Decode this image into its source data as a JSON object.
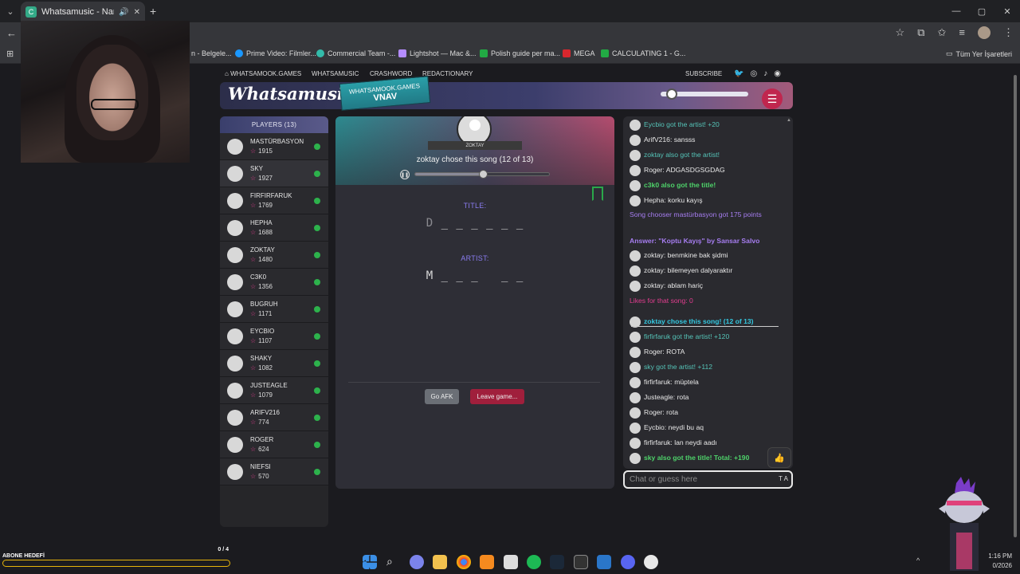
{
  "browser": {
    "tab_title": "Whatsamusic - Name That",
    "tab_menu": "⌄",
    "new_tab": "+",
    "win_controls": [
      "—",
      "▢",
      "✕"
    ],
    "back": "←",
    "bookmarks": [
      {
        "label": "n - Belgele...",
        "color": "#888888"
      },
      {
        "label": "Prime Video: Filmler...",
        "color": "#1a98ff"
      },
      {
        "label": "Commercial Team -...",
        "color": "#33bbaa"
      },
      {
        "label": "Lightshot — Mac &...",
        "color": "#b48cff"
      },
      {
        "label": "Polish guide per ma...",
        "color": "#22aa44"
      },
      {
        "label": "MEGA",
        "color": "#d9272e"
      },
      {
        "label": "CALCULATING 1 - G...",
        "color": "#22aa44"
      }
    ],
    "bookmarks_right": "Tüm Yer İşaretleri"
  },
  "site_nav": {
    "home": "WHATSAMOOK.GAMES",
    "links": [
      "WHATSAMUSIC",
      "CRASHWORD",
      "REDACTIONARY"
    ],
    "subscribe": "SUBSCRIBE"
  },
  "header": {
    "logo": "Whatsamusic",
    "badge_top": "WHATSAMOOK.GAMES",
    "badge_bottom": "VNAV",
    "menu_icon": "☰"
  },
  "players": {
    "title": "PLAYERS (13)",
    "list": [
      {
        "name": "MASTÜRBASYON",
        "score": "1915"
      },
      {
        "name": "SKY",
        "score": "1927"
      },
      {
        "name": "FIRFIRFARUK",
        "score": "1769"
      },
      {
        "name": "HEPHA",
        "score": "1688"
      },
      {
        "name": "ZOKTAY",
        "score": "1480"
      },
      {
        "name": "C3K0",
        "score": "1356"
      },
      {
        "name": "BUGRUH",
        "score": "1171"
      },
      {
        "name": "EYCBIO",
        "score": "1107"
      },
      {
        "name": "SHAKY",
        "score": "1082"
      },
      {
        "name": "JUSTEAGLE",
        "score": "1079"
      },
      {
        "name": "ARIFV216",
        "score": "774"
      },
      {
        "name": "ROGER",
        "score": "624"
      },
      {
        "name": "NIEFSI",
        "score": "570"
      }
    ]
  },
  "game": {
    "chooser_ribbon": "ZOKTAY",
    "status": "zoktay chose this song (12 of 13)",
    "progress": 0.52,
    "title_label": "TITLE:",
    "title_first": "D",
    "title_hint": "_ _ _ _ _ _",
    "artist_label": "ARTIST:",
    "artist_hint": "M _ _ _   _ _",
    "afk_button": "Go AFK",
    "leave_button": "Leave game..."
  },
  "chat": {
    "messages": [
      {
        "text": "Eycbio got the artist! +20",
        "style": "cl-teal",
        "avatar": true
      },
      {
        "text": "ArifV216: sansss",
        "style": "",
        "avatar": true
      },
      {
        "text": "zoktay also got the artist!",
        "style": "cl-teal",
        "avatar": true
      },
      {
        "text": "Roger: ADGASDGSGDAG",
        "style": "",
        "avatar": true
      },
      {
        "text": "c3k0 also got the title!",
        "style": "cl-green",
        "avatar": true
      },
      {
        "text": "Hepha: korku kayış",
        "style": "",
        "avatar": true
      },
      {
        "text": "Song chooser mastürbasyon got 175 points",
        "style": "cl-purple",
        "avatar": false
      },
      {
        "text": "Answer: \"Koptu Kayış\" by Sansar Salvo",
        "style": "cl-purple-b",
        "avatar": false
      },
      {
        "text": "zoktay: benmkine bak şidmi",
        "style": "",
        "avatar": true
      },
      {
        "text": "zoktay: bilemeyen dalyaraktır",
        "style": "",
        "avatar": true
      },
      {
        "text": "zoktay: ablam hariç",
        "style": "",
        "avatar": true
      },
      {
        "text": "Likes for that song: 0",
        "style": "cl-pink",
        "avatar": false
      },
      {
        "text": "zoktay chose this song! (12 of 13)",
        "style": "cl-cyan-b",
        "avatar": true
      },
      {
        "text": "firfirfaruk got the artist! +120",
        "style": "cl-teal",
        "avatar": true
      },
      {
        "text": "Roger: ROTA",
        "style": "",
        "avatar": true
      },
      {
        "text": "sky got the artist! +112",
        "style": "cl-teal",
        "avatar": true
      },
      {
        "text": "firfirfaruk: müptela",
        "style": "",
        "avatar": true
      },
      {
        "text": "Justeagle: rota",
        "style": "",
        "avatar": true
      },
      {
        "text": "Roger: rota",
        "style": "",
        "avatar": true
      },
      {
        "text": "Eycbio: neydi bu aq",
        "style": "",
        "avatar": true
      },
      {
        "text": "firfirfaruk: lan neydi aadı",
        "style": "",
        "avatar": true
      },
      {
        "text": "sky also got the title! Total: +190",
        "style": "cl-green",
        "avatar": true
      }
    ],
    "input_placeholder": "Chat or guess here",
    "text_size_label": "T A",
    "like_icon": "👍"
  },
  "stream": {
    "goal_label": "ABONE HEDEFİ",
    "goal_count": "0 / 4",
    "goal_progress": 0
  },
  "taskbar": {
    "clock_time": "1:16 PM",
    "clock_date": "0/2026",
    "tray_up": "^"
  },
  "colors": {
    "accent_pink": "#c0264e",
    "player_star": "#e23d8f",
    "online_dot": "#2db24c",
    "label_purple": "#8a7cf0"
  }
}
